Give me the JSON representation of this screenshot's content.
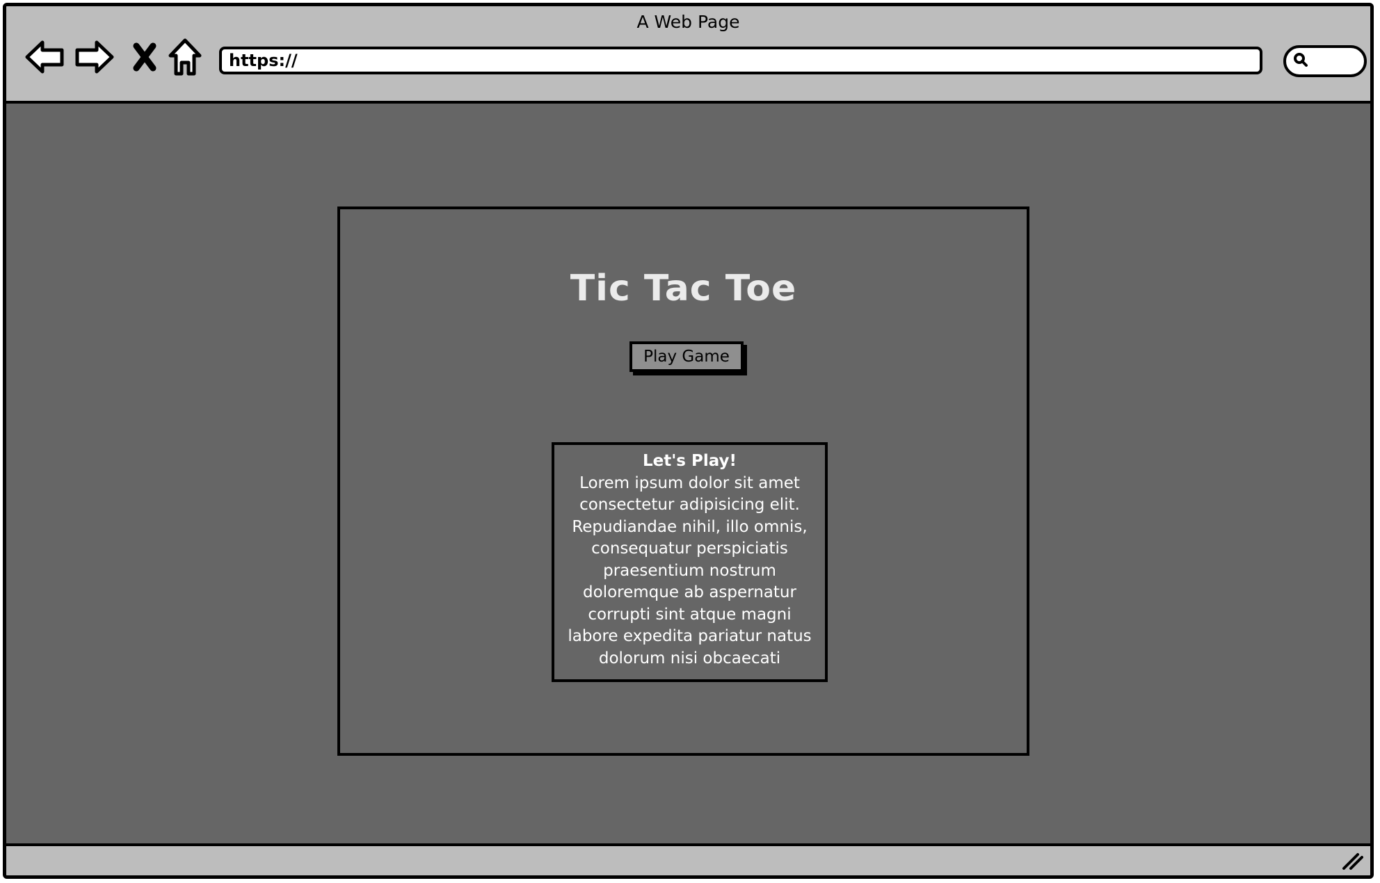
{
  "browser": {
    "title": "A Web Page",
    "url": "https://",
    "icons": {
      "back": "back-arrow-icon",
      "forward": "forward-arrow-icon",
      "stop": "close-x-icon",
      "home": "home-icon",
      "search": "search-icon",
      "resize": "resize-grip-icon"
    }
  },
  "page": {
    "title": "Tic Tac Toe",
    "play_button_label": "Play Game",
    "info": {
      "heading": "Let's Play!",
      "lines": [
        "Lorem ipsum dolor sit amet",
        "consectetur adipisicing elit.",
        "Repudiandae nihil, illo omnis,",
        "consequatur perspiciatis",
        "praesentium nostrum",
        "doloremque ab aspernatur",
        "corrupti sint atque magni",
        "labore expedita pariatur natus",
        "dolorum nisi obcaecati"
      ]
    }
  },
  "colors": {
    "chrome": "#bdbdbd",
    "viewport": "#666666",
    "button": "#8f8f8f",
    "title_text": "#ebebeb",
    "body_text": "#ffffff"
  }
}
